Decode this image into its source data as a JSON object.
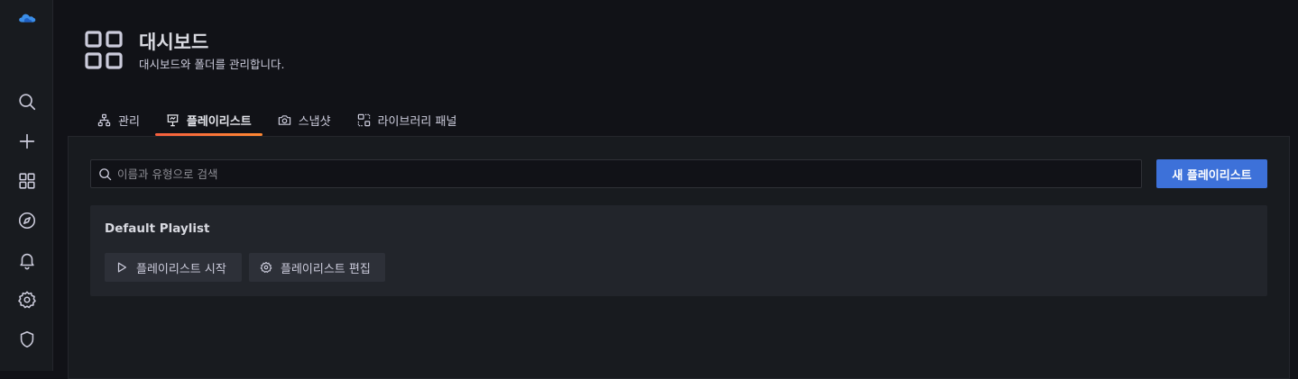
{
  "colors": {
    "background": "#111217",
    "panel": "#181b1f",
    "card": "#22252b",
    "primary": "#3d71d9",
    "tab_underline": "#ff7033"
  },
  "sidebar": {
    "items": [
      {
        "name": "grafana-logo",
        "icon": "cloud-logo-icon"
      },
      {
        "name": "search",
        "icon": "search-icon"
      },
      {
        "name": "create",
        "icon": "plus-icon"
      },
      {
        "name": "dashboards",
        "icon": "apps-icon"
      },
      {
        "name": "explore",
        "icon": "compass-icon"
      },
      {
        "name": "alerting",
        "icon": "bell-icon"
      },
      {
        "name": "configuration",
        "icon": "cog-icon"
      },
      {
        "name": "server-admin",
        "icon": "shield-icon"
      }
    ]
  },
  "header": {
    "icon": "apps-icon",
    "title": "대시보드",
    "subtitle": "대시보드와 폴더를 관리합니다."
  },
  "tabs": [
    {
      "label": "관리",
      "icon": "sitemap-icon",
      "active": false
    },
    {
      "label": "플레이리스트",
      "icon": "presentation-icon",
      "active": true
    },
    {
      "label": "스냅샷",
      "icon": "camera-icon",
      "active": false
    },
    {
      "label": "라이브러리 패널",
      "icon": "library-panel-icon",
      "active": false
    }
  ],
  "search": {
    "placeholder": "이름과 유형으로 검색",
    "value": ""
  },
  "new_button_label": "새 플레이리스트",
  "playlist": {
    "title": "Default Playlist",
    "start_label": "플레이리스트 시작",
    "edit_label": "플레이리스트 편집"
  }
}
